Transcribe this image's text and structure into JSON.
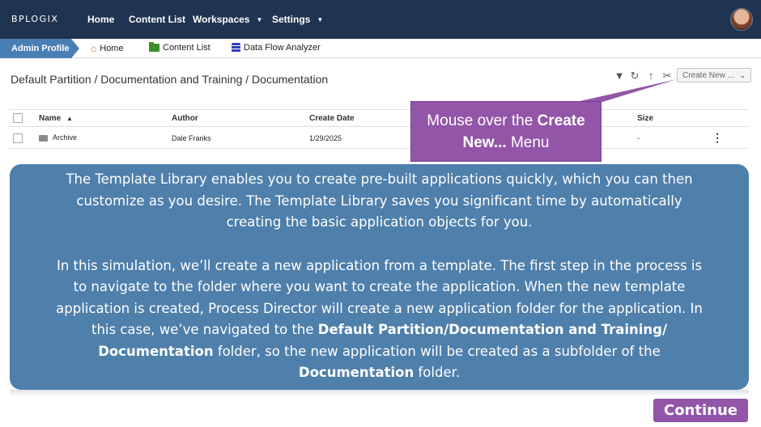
{
  "header": {
    "logo_text": "BPLOGIX",
    "logo_sub": "™",
    "nav": [
      {
        "label": "Home"
      },
      {
        "label": "Content List"
      },
      {
        "label": "Workspaces"
      },
      {
        "label": "Settings"
      }
    ]
  },
  "subbar": {
    "profile_tab": "Admin Profile",
    "links": [
      {
        "label": "Home",
        "icon": "home-icon"
      },
      {
        "label": "Content List",
        "icon": "folder-icon"
      },
      {
        "label": "Data Flow Analyzer",
        "icon": "database-icon"
      }
    ]
  },
  "breadcrumb": "Default Partition / Documentation and Training / Documentation",
  "toolbar": {
    "icons": [
      "filter-icon",
      "refresh-icon",
      "up-arrow-icon",
      "tools-icon"
    ],
    "create_new_label": "Create New ..."
  },
  "table": {
    "columns": [
      "Name",
      "Author",
      "Create Date",
      "Size"
    ],
    "rows": [
      {
        "name": "Archive",
        "author": "Dale Franks",
        "create_date": "1/29/2025",
        "size": "-"
      }
    ]
  },
  "callout": {
    "line1_prefix": "Mouse over the ",
    "line1_bold": "Create",
    "line2_bold": "New...",
    "line2_suffix": " Menu"
  },
  "info": {
    "para1_lines": [
      "The Template Library enables you to create pre-built applications quickly, which you can then",
      "customize as you desire. The Template Library saves you significant time by automatically",
      "creating the basic application objects for you."
    ],
    "para2_lines": [
      "In this simulation, we’ll create a new application from a template. The first step in the process is",
      "to navigate to the folder where you want to create the application. When the new template",
      "application is created, Process Director will create a new application folder for the application. In"
    ],
    "l4_prefix": "this case, we’ve navigated to the ",
    "l4_bold": "Default Partition/Documentation and Training/",
    "l5_bold": "Documentation",
    "l5_suffix": " folder, so the new application will be created as a subfolder of the",
    "l6_bold": "Documentation",
    "l6_suffix": " folder."
  },
  "continue_label": "Continue",
  "colors": {
    "topbar": "#1f3450",
    "accent_purple": "#9355a8",
    "info_panel": "#4f7fab",
    "admin_tab": "#4a7fb5"
  }
}
